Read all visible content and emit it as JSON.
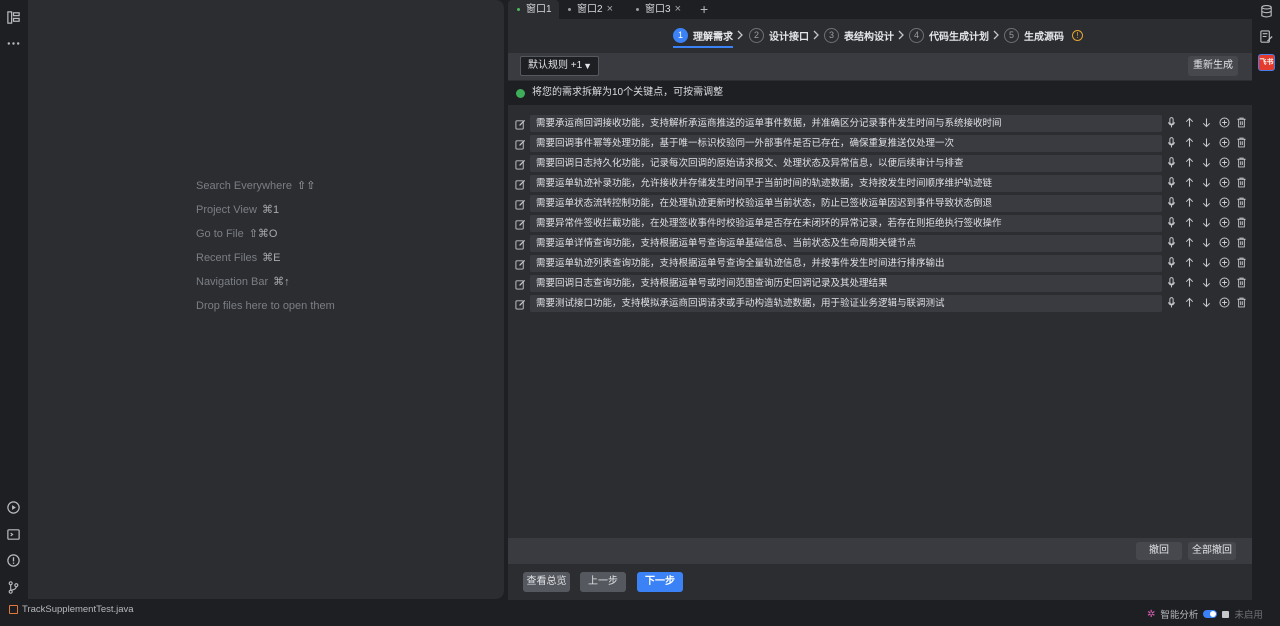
{
  "editor": {
    "hints": [
      {
        "label": "Search Everywhere",
        "shortcut": "⇧⇧"
      },
      {
        "label": "Project View",
        "shortcut": "⌘1"
      },
      {
        "label": "Go to File",
        "shortcut": "⇧⌘O"
      },
      {
        "label": "Recent Files",
        "shortcut": "⌘E"
      },
      {
        "label": "Navigation Bar",
        "shortcut": "⌘↑"
      },
      {
        "label": "Drop files here to open them",
        "shortcut": ""
      }
    ]
  },
  "tabs": [
    {
      "label": "窗口1",
      "active": true
    },
    {
      "label": "窗口2",
      "active": false
    },
    {
      "label": "窗口3",
      "active": false
    }
  ],
  "tab_add": "+",
  "steps": [
    {
      "num": "1",
      "label": "理解需求",
      "active": true
    },
    {
      "num": "2",
      "label": "设计接口",
      "active": false
    },
    {
      "num": "3",
      "label": "表结构设计",
      "active": false
    },
    {
      "num": "4",
      "label": "代码生成计划",
      "active": false
    },
    {
      "num": "5",
      "label": "生成源码",
      "active": false
    }
  ],
  "toolbar": {
    "rule_select": "默认规则 +1",
    "regenerate": "重新生成"
  },
  "notice": "将您的需求拆解为10个关键点，可按需调整",
  "requirements": [
    "需要承运商回调接收功能，支持解析承运商推送的运单事件数据，并准确区分记录事件发生时间与系统接收时间",
    "需要回调事件幂等处理功能，基于唯一标识校验同一外部事件是否已存在，确保重复推送仅处理一次",
    "需要回调日志持久化功能，记录每次回调的原始请求报文、处理状态及异常信息，以便后续审计与排查",
    "需要运单轨迹补录功能，允许接收并存储发生时间早于当前时间的轨迹数据，支持按发生时间顺序维护轨迹链",
    "需要运单状态流转控制功能，在处理轨迹更新时校验运单当前状态，防止已签收运单因迟到事件导致状态倒退",
    "需要异常件签收拦截功能，在处理签收事件时校验运单是否存在未闭环的异常记录，若存在则拒绝执行签收操作",
    "需要运单详情查询功能，支持根据运单号查询运单基础信息、当前状态及生命周期关键节点",
    "需要运单轨迹列表查询功能，支持根据运单号查询全量轨迹信息，并按事件发生时间进行排序输出",
    "需要回调日志查询功能，支持根据运单号或时间范围查询历史回调记录及其处理结果",
    "需要测试接口功能，支持模拟承运商回调请求或手动构造轨迹数据，用于验证业务逻辑与联调测试"
  ],
  "bottom": {
    "undo": "撤回",
    "undo_all": "全部撤回"
  },
  "nav": {
    "overview": "查看总览",
    "prev": "上一步",
    "next": "下一步"
  },
  "status": {
    "file": "TrackSupplementTest.java",
    "ai_label": "智能分析",
    "disabled": "未启用"
  },
  "right_badge": "飞书",
  "colors": {
    "accent": "#3b82f6",
    "success": "#3fae5a",
    "warning": "#e7a532"
  }
}
